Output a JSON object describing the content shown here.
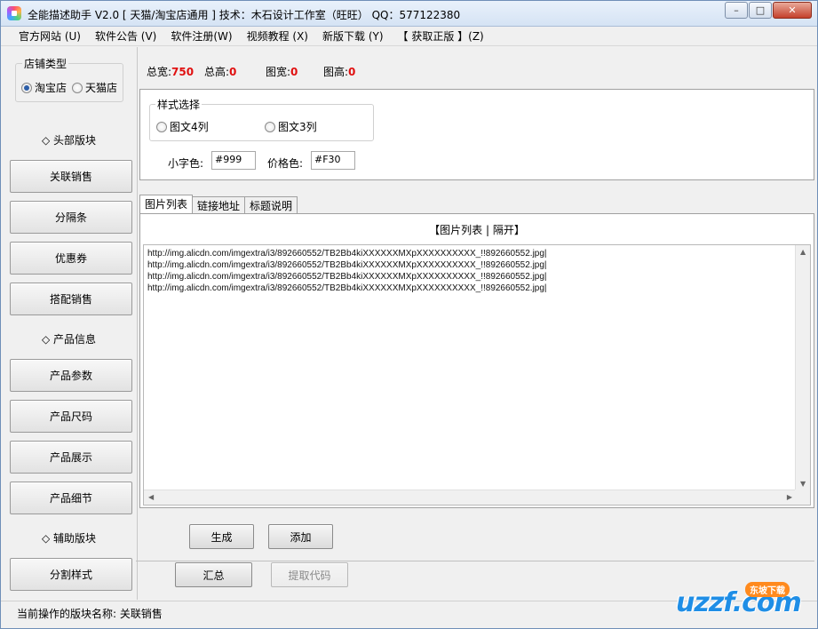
{
  "window": {
    "title": "全能描述助手 V2.0 [ 天猫/淘宝店通用 ]  技术：木石设计工作室（旺旺）  QQ：577122380",
    "minimize_glyph": "–",
    "maximize_glyph": "□",
    "close_glyph": "✕"
  },
  "menu": [
    "官方网站 (U)",
    "软件公告 (V)",
    "软件注册(W)",
    "视频教程 (X)",
    "新版下载 (Y)",
    "【 获取正版 】(Z)"
  ],
  "sidebar": {
    "shop_type_title": "店铺类型",
    "shop_types": [
      {
        "label": "淘宝店",
        "checked": true
      },
      {
        "label": "天猫店",
        "checked": false
      }
    ],
    "sections": [
      {
        "label": "◇ 头部版块"
      },
      {
        "label": "◇ 产品信息"
      },
      {
        "label": "◇ 辅助版块"
      }
    ],
    "buttons": [
      "关联销售",
      "分隔条",
      "优惠券",
      "搭配销售",
      "产品参数",
      "产品尺码",
      "产品展示",
      "产品细节",
      "分割样式"
    ]
  },
  "info": {
    "total_width_label": "总宽:",
    "total_width_value": "750",
    "total_height_label": "总高:",
    "total_height_value": "0",
    "img_width_label": "图宽:",
    "img_width_value": "0",
    "img_height_label": "图高:",
    "img_height_value": "0"
  },
  "style_panel": {
    "group_title": "样式选择",
    "options": [
      {
        "label": "图文4列",
        "checked": false
      },
      {
        "label": "图文3列",
        "checked": false
      }
    ],
    "small_color_label": "小字色:",
    "small_color_value": "#999",
    "price_color_label": "价格色:",
    "price_color_value": "#F30"
  },
  "tabs": [
    "图片列表",
    "链接地址",
    "标题说明"
  ],
  "tab_content": {
    "heading": "【图片列表 | 隔开】",
    "lines": [
      "http://img.alicdn.com/imgextra/i3/892660552/TB2Bb4kiXXXXXXMXpXXXXXXXXXX_!!892660552.jpg|",
      "http://img.alicdn.com/imgextra/i3/892660552/TB2Bb4kiXXXXXXMXpXXXXXXXXXX_!!892660552.jpg|",
      "http://img.alicdn.com/imgextra/i3/892660552/TB2Bb4kiXXXXXXMXpXXXXXXXXXX_!!892660552.jpg|",
      "http://img.alicdn.com/imgextra/i3/892660552/TB2Bb4kiXXXXXXMXpXXXXXXXXXX_!!892660552.jpg|"
    ]
  },
  "actions": {
    "generate": "生成",
    "add": "添加",
    "summary": "汇总",
    "extract_code": "提取代码"
  },
  "status": {
    "text": "当前操作的版块名称: 关联销售"
  },
  "watermark": {
    "text": "uzzf.com",
    "badge": "东坡下载"
  },
  "colors": {
    "value_red": "#e01010",
    "selected_radio": "#2d5ea8",
    "watermark_blue": "#1f8ee6"
  }
}
